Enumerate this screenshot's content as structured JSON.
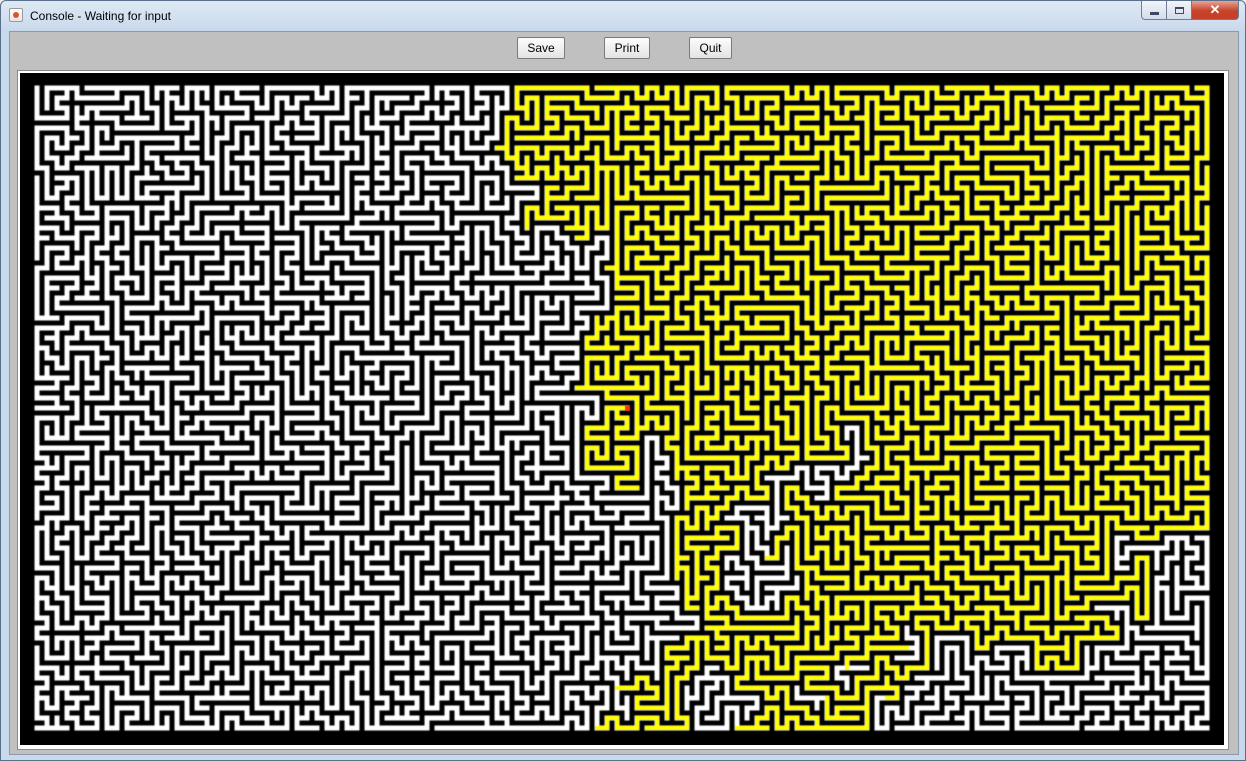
{
  "window": {
    "title": "Console - Waiting for input",
    "app_icon": "java-cup-icon",
    "controls": {
      "minimize": "minimize-icon",
      "maximize": "maximize-icon",
      "close": "✕"
    }
  },
  "toolbar": {
    "save_label": "Save",
    "print_label": "Print",
    "quit_label": "Quit"
  },
  "maze": {
    "wall_color": "#000000",
    "corridor_color": "#ffffff",
    "path_color": "#ffff00",
    "marker_color": "#ff3300"
  }
}
